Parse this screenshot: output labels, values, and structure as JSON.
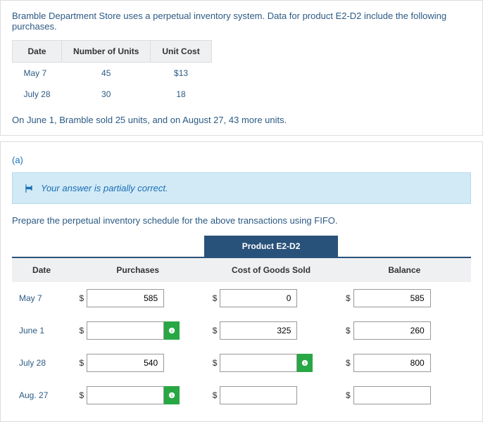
{
  "problem": {
    "intro": "Bramble Department Store uses a perpetual inventory system. Data for product E2-D2 include the following purchases.",
    "headers": {
      "date": "Date",
      "units": "Number of Units",
      "cost": "Unit Cost"
    },
    "rows": [
      {
        "date": "May 7",
        "units": "45",
        "cost": "$13"
      },
      {
        "date": "July 28",
        "units": "30",
        "cost": "18"
      }
    ],
    "note": "On June 1, Bramble sold 25 units, and on August 27, 43 more units."
  },
  "part": {
    "label": "(a)",
    "alert": "Your answer is partially correct.",
    "instruction": "Prepare the perpetual inventory schedule for the above transactions using FIFO.",
    "product_header": "Product E2-D2",
    "cols": {
      "date": "Date",
      "purchases": "Purchases",
      "cogs": "Cost of Goods Sold",
      "balance": "Balance"
    },
    "rows": [
      {
        "date": "May 7",
        "purchases": {
          "value": "585",
          "marker": false
        },
        "cogs": {
          "value": "0",
          "marker": false
        },
        "balance": {
          "value": "585",
          "marker": false
        }
      },
      {
        "date": "June 1",
        "purchases": {
          "value": "",
          "marker": true
        },
        "cogs": {
          "value": "325",
          "marker": false
        },
        "balance": {
          "value": "260",
          "marker": false
        }
      },
      {
        "date": "July 28",
        "purchases": {
          "value": "540",
          "marker": false
        },
        "cogs": {
          "value": "",
          "marker": true
        },
        "balance": {
          "value": "800",
          "marker": false
        }
      },
      {
        "date": "Aug. 27",
        "purchases": {
          "value": "",
          "marker": true
        },
        "cogs": {
          "value": "",
          "marker": false
        },
        "balance": {
          "value": "",
          "marker": false
        }
      }
    ]
  }
}
